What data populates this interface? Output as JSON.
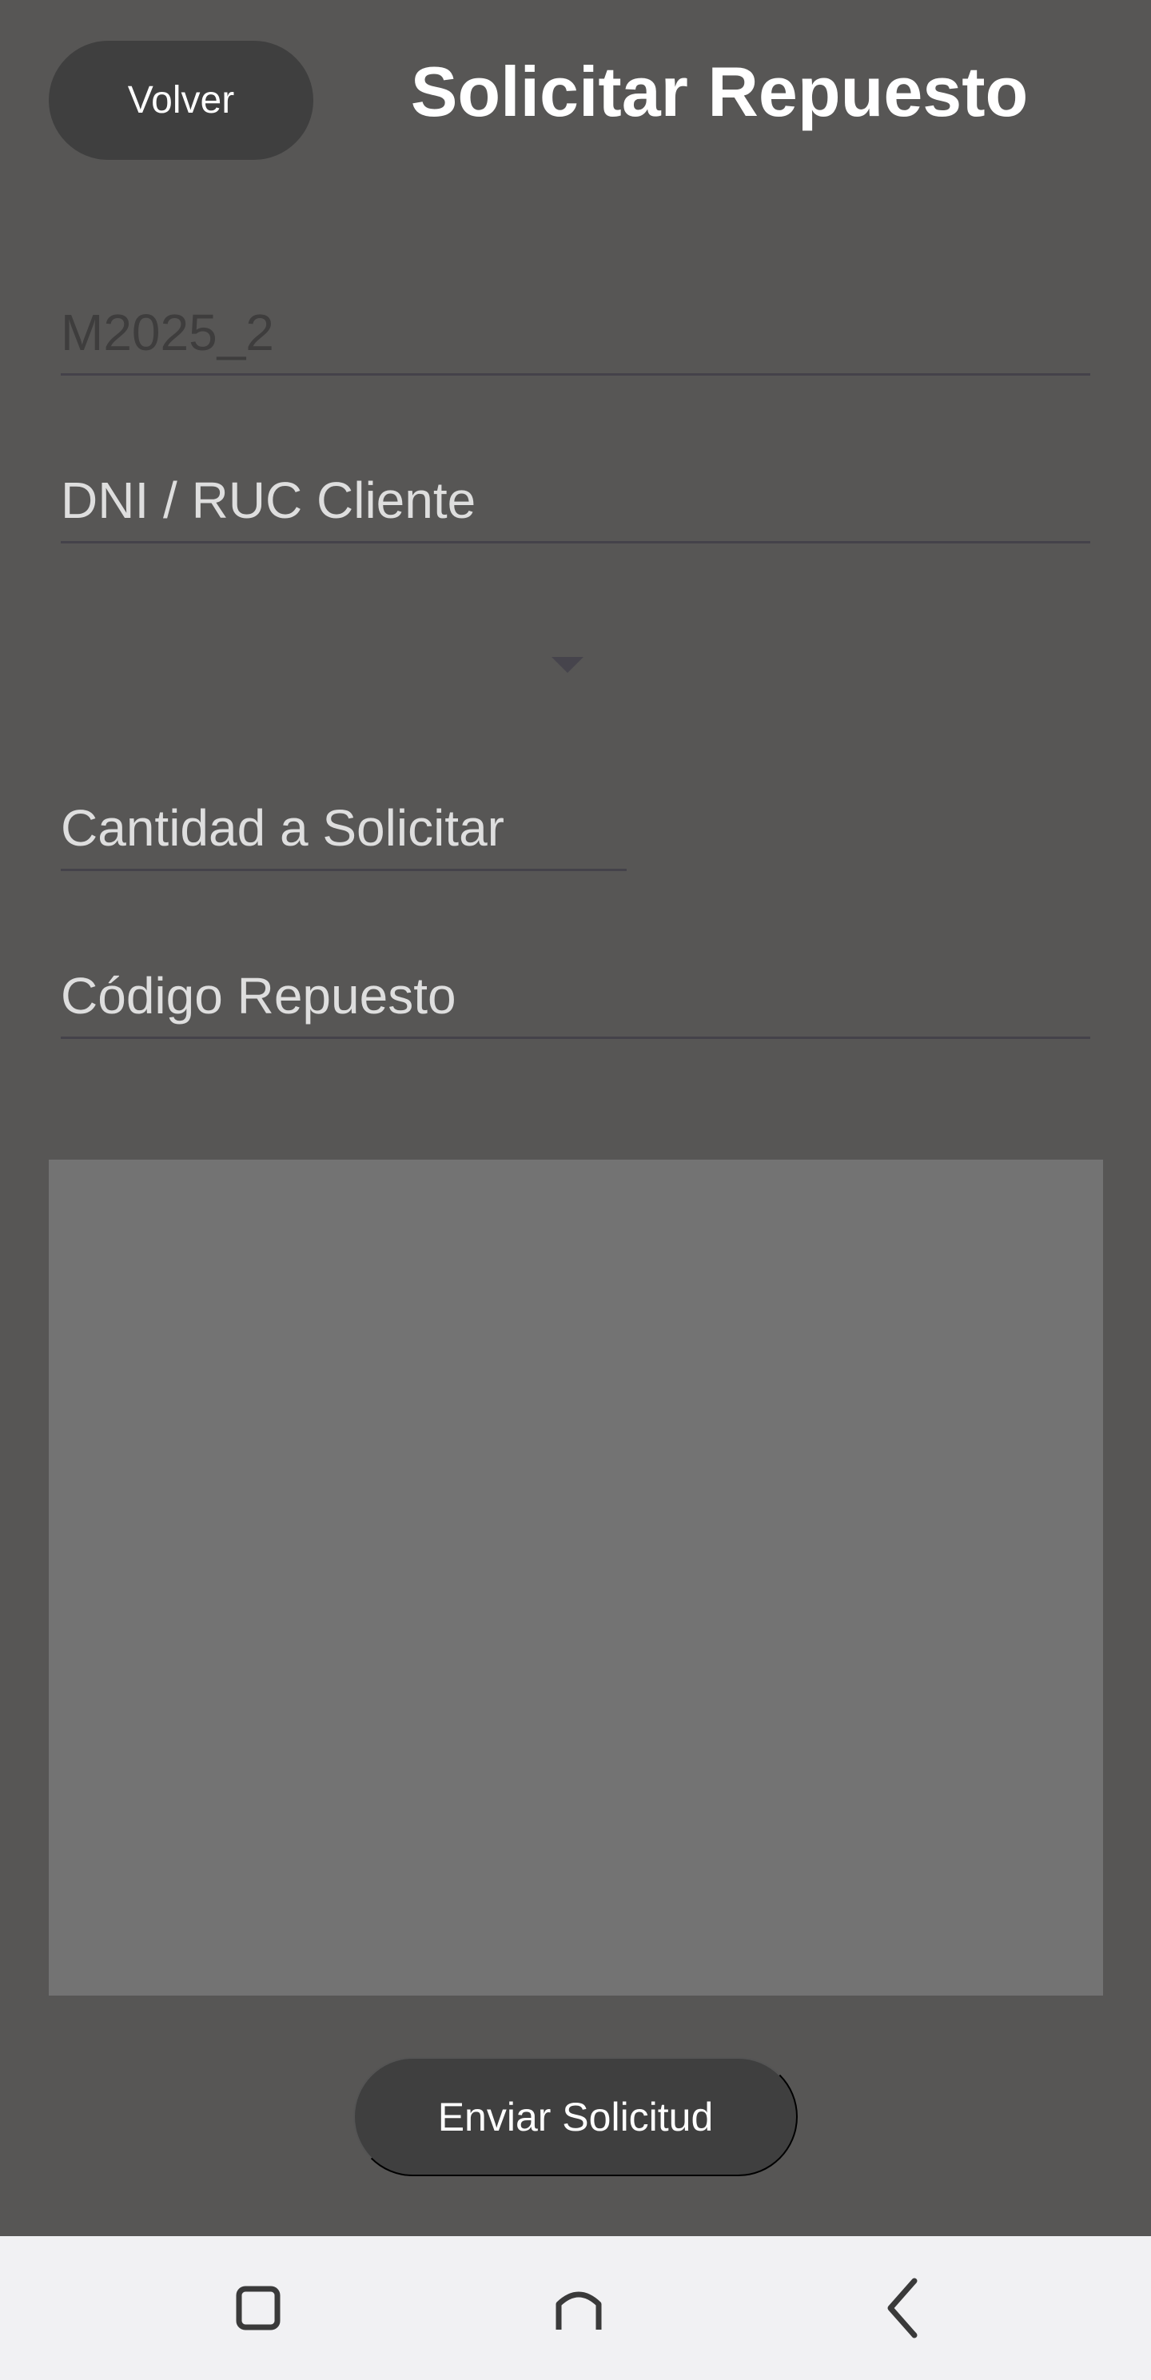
{
  "header": {
    "back_label": "Volver",
    "title": "Solicitar Repuesto"
  },
  "form": {
    "code_value": "M2025_2",
    "client_id_placeholder": "DNI / RUC Cliente",
    "quantity_placeholder": "Cantidad a Solicitar",
    "part_code_placeholder": "Código Repuesto"
  },
  "actions": {
    "submit_label": "Enviar Solicitud"
  },
  "nav": {
    "recents_icon": "square-icon",
    "home_icon": "home-icon",
    "back_icon": "chevron-left-icon"
  },
  "colors": {
    "background": "#575655",
    "button": "#3f3f3f",
    "panel": "#737373",
    "nav_bar": "#f1f1f3"
  }
}
